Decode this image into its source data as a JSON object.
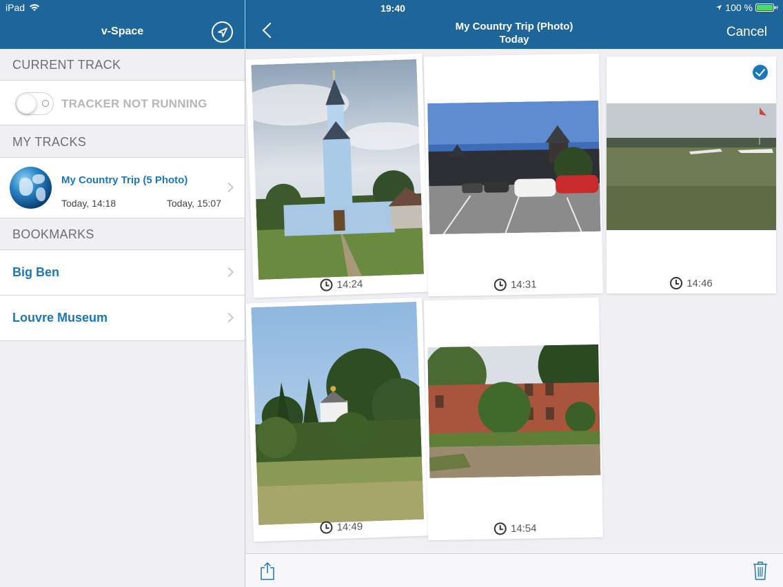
{
  "status": {
    "device": "iPad",
    "time": "19:40",
    "battery": "100 %"
  },
  "sidebar": {
    "title": "v-Space",
    "current_track_header": "CURRENT TRACK",
    "tracker_status": "TRACKER NOT RUNNING",
    "my_tracks_header": "MY TRACKS",
    "track": {
      "name": "My Country Trip (5 Photo)",
      "start": "Today, 14:18",
      "end": "Today, 15:07"
    },
    "bookmarks_header": "BOOKMARKS",
    "bookmarks": [
      {
        "label": "Big Ben"
      },
      {
        "label": "Louvre Museum"
      }
    ]
  },
  "detail": {
    "title": "My Country Trip (Photo)",
    "subtitle": "Today",
    "cancel_label": "Cancel",
    "photos": [
      {
        "time": "14:24",
        "selected": false
      },
      {
        "time": "14:31",
        "selected": false
      },
      {
        "time": "14:46",
        "selected": true
      },
      {
        "time": "14:49",
        "selected": false
      },
      {
        "time": "14:54",
        "selected": false
      }
    ]
  },
  "colors": {
    "nav_bar": "#1e6699",
    "accent": "#1b77b8",
    "background": "#efeff4"
  },
  "icons": {
    "location": "location-arrow-icon",
    "share": "share-icon",
    "trash": "trash-icon",
    "clock": "clock-icon",
    "check": "checkmark-icon"
  }
}
